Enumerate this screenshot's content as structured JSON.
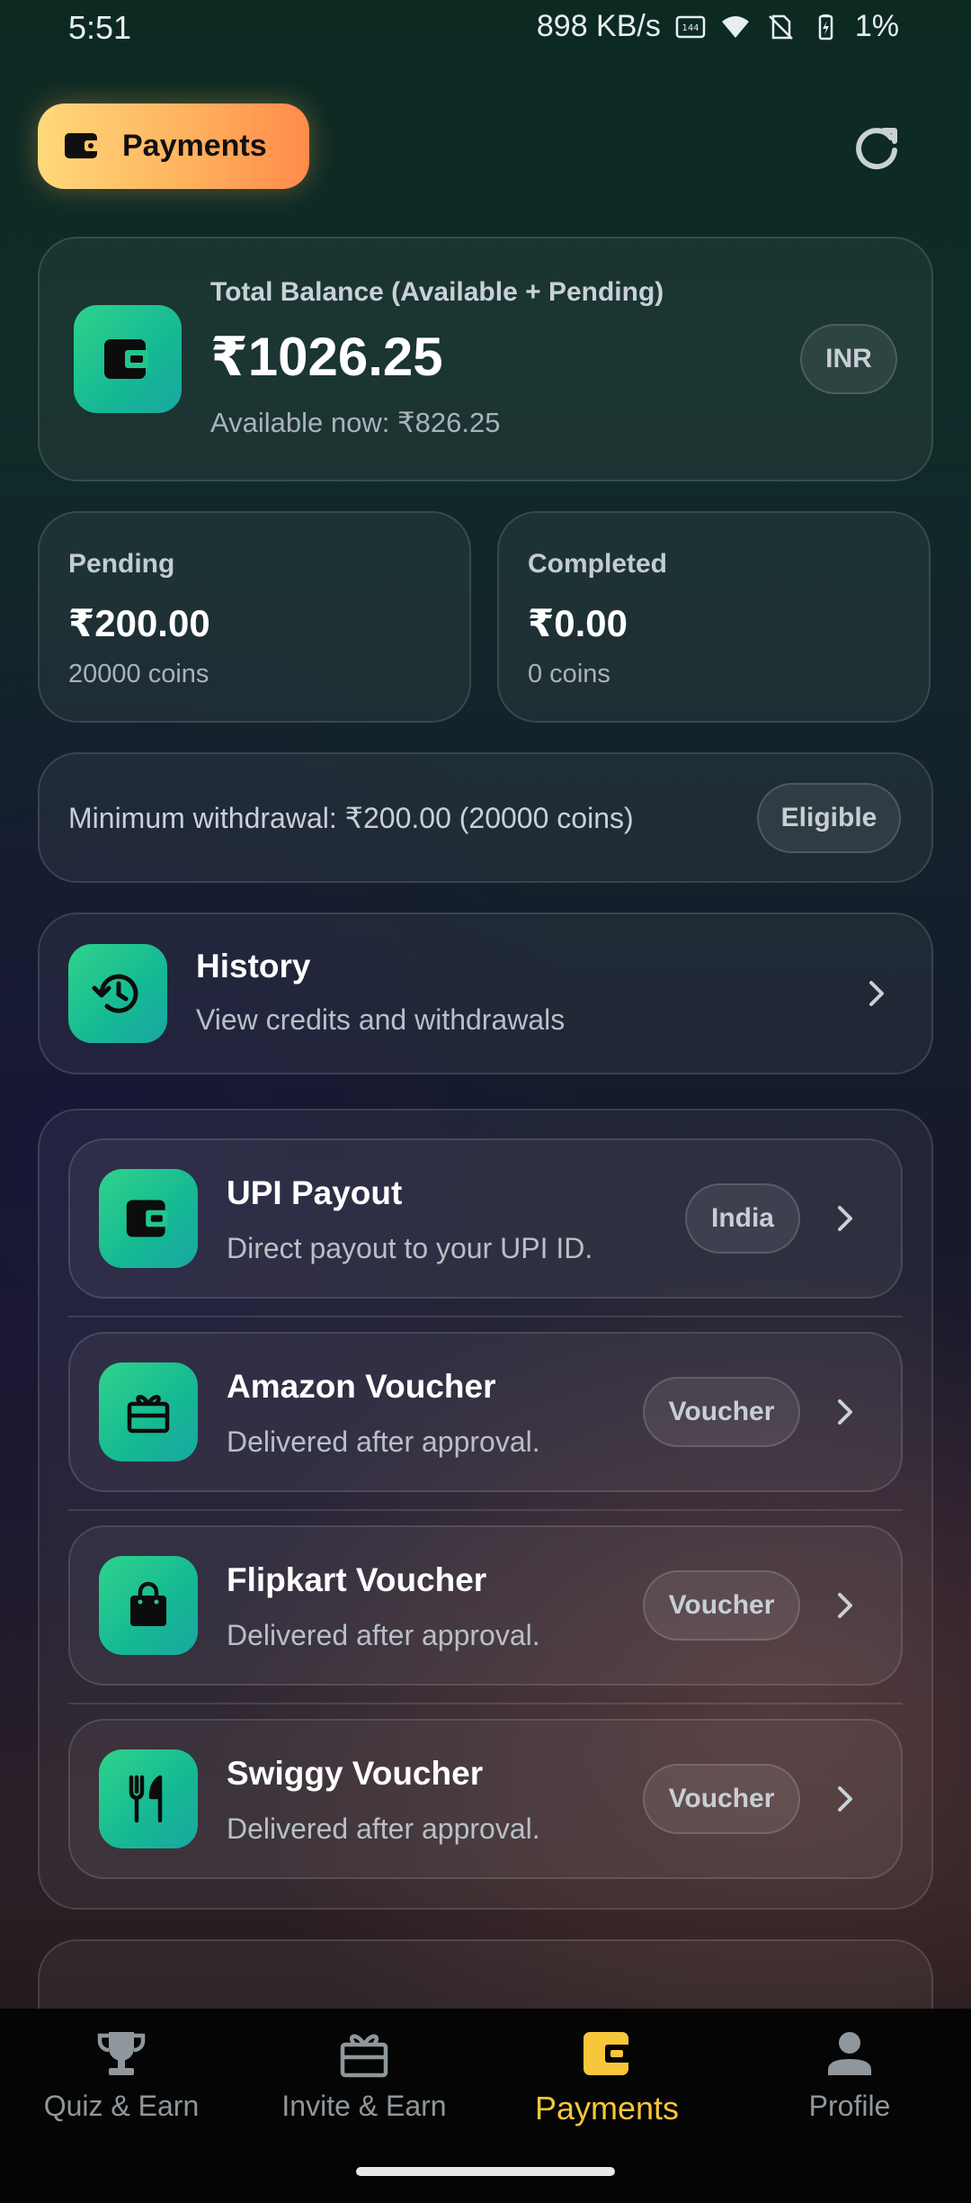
{
  "status_bar": {
    "time": "5:51",
    "network_speed": "898 KB/s",
    "battery": "1%"
  },
  "header": {
    "title": "Payments",
    "refresh_icon": "refresh-icon"
  },
  "balance": {
    "label": "Total Balance (Available + Pending)",
    "value": "₹1026.25",
    "available": "Available now: ₹826.25",
    "currency_chip": "INR"
  },
  "stats": {
    "pending": {
      "label": "Pending",
      "value": "₹200.00",
      "coins": "20000 coins"
    },
    "completed": {
      "label": "Completed",
      "value": "₹0.00",
      "coins": "0 coins"
    }
  },
  "withdrawal": {
    "text": "Minimum withdrawal: ₹200.00 (20000 coins)",
    "chip": "Eligible"
  },
  "history": {
    "title": "History",
    "subtitle": "View credits and withdrawals"
  },
  "options": [
    {
      "title": "UPI Payout",
      "subtitle": "Direct payout to your UPI ID.",
      "chip": "India",
      "icon": "wallet-icon"
    },
    {
      "title": "Amazon Voucher",
      "subtitle": "Delivered after approval.",
      "chip": "Voucher",
      "icon": "gift-icon"
    },
    {
      "title": "Flipkart Voucher",
      "subtitle": "Delivered after approval.",
      "chip": "Voucher",
      "icon": "shopping-bag-icon"
    },
    {
      "title": "Swiggy Voucher",
      "subtitle": "Delivered after approval.",
      "chip": "Voucher",
      "icon": "restaurant-icon"
    }
  ],
  "bottom_nav": [
    {
      "label": "Quiz & Earn",
      "icon": "trophy-icon",
      "active": false
    },
    {
      "label": "Invite & Earn",
      "icon": "gift-icon",
      "active": false
    },
    {
      "label": "Payments",
      "icon": "wallet-icon",
      "active": true
    },
    {
      "label": "Profile",
      "icon": "person-icon",
      "active": false
    }
  ],
  "colors": {
    "accent_green": "#2fd38a",
    "accent_orange": "#ffb25e",
    "active_nav": "#f7c63a"
  }
}
